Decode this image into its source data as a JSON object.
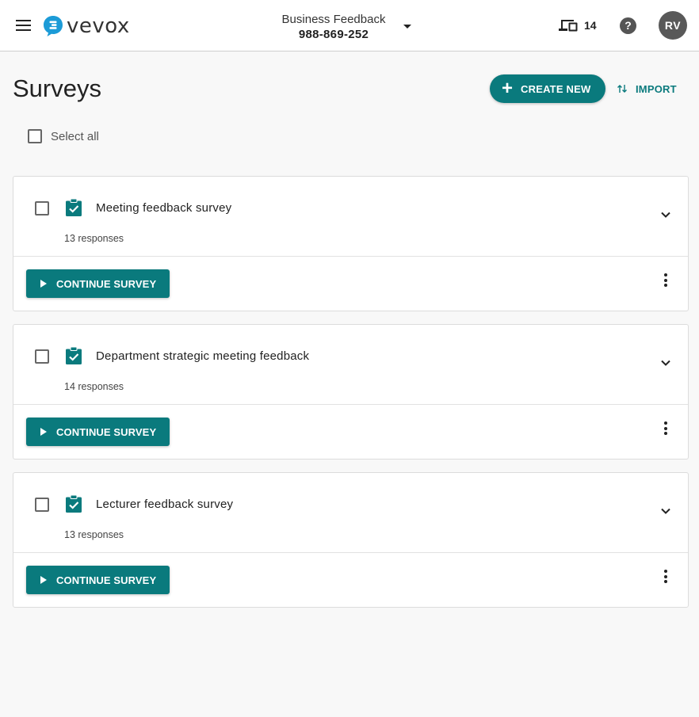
{
  "header": {
    "logo_text": "vevox",
    "event_name": "Business Feedback",
    "event_code": "988-869-252",
    "device_count": "14",
    "help_symbol": "?",
    "avatar_initials": "RV"
  },
  "page": {
    "title": "Surveys",
    "create_label": "CREATE NEW",
    "import_label": "IMPORT",
    "select_all_label": "Select all"
  },
  "surveys": [
    {
      "title": "Meeting feedback survey",
      "responses": "13 responses",
      "action_label": "CONTINUE SURVEY"
    },
    {
      "title": "Department strategic meeting feedback",
      "responses": "14 responses",
      "action_label": "CONTINUE SURVEY"
    },
    {
      "title": "Lecturer feedback survey",
      "responses": "13 responses",
      "action_label": "CONTINUE SURVEY"
    }
  ],
  "colors": {
    "accent": "#0a7a7d",
    "avatar_bg": "#595959",
    "logo_blue": "#1c9bd7"
  },
  "icons": {
    "menu": "hamburger-menu-icon",
    "devices": "devices-icon",
    "help": "help-icon",
    "add": "plus-icon",
    "import": "swap-vertical-icon",
    "survey": "clipboard-check-icon",
    "expand": "chevron-down-icon",
    "more": "more-vertical-icon",
    "play": "play-icon"
  }
}
